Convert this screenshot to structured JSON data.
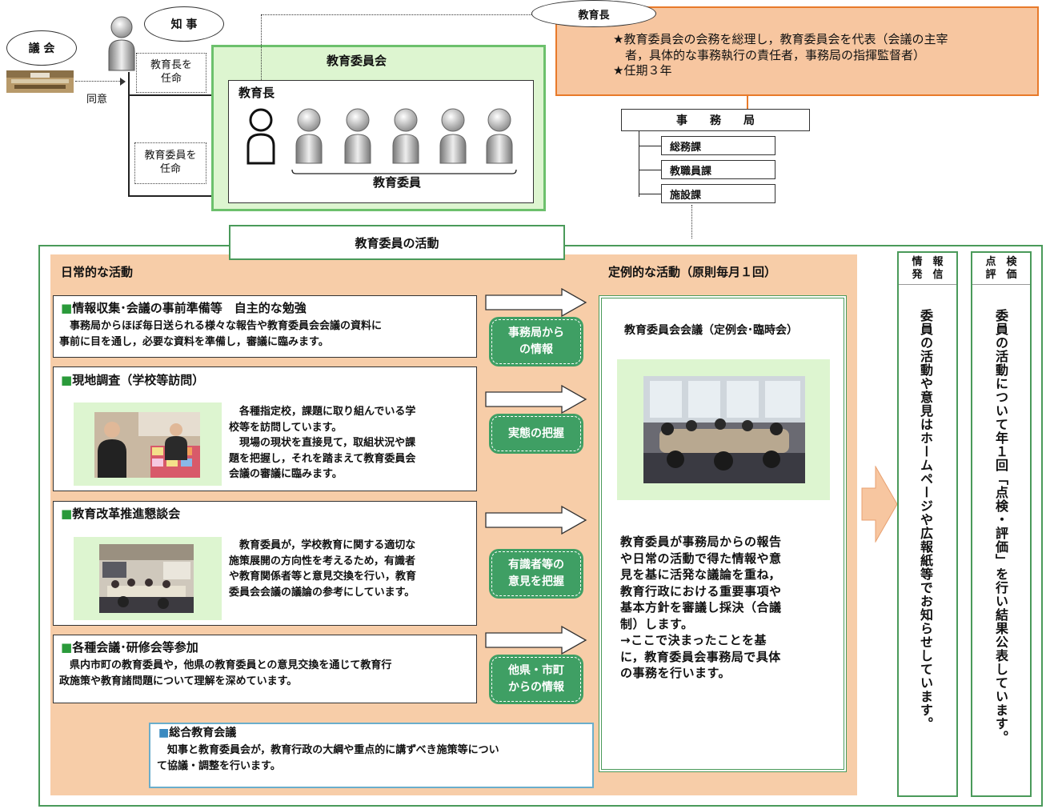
{
  "top": {
    "gikai_label": "議 会",
    "chiji_label": "知 事",
    "kyoikucho_label": "教育長",
    "appoint_superintendent": "教育長を\n任命",
    "appoint_members": "教育委員を\n任命",
    "consent_label": "同意",
    "board_title": "教育委員会",
    "board_superintendent": "教育長",
    "board_members": "教育委員",
    "superintendent_desc": "★教育委員会の会務を総理し，教育委員会を代表（会議の主宰\n　者，具体的な事務執行の責任者，事務局の指揮監督者）\n★任期３年",
    "secretariat": "事　　務　　局",
    "sections": [
      "総務課",
      "教職員課",
      "施設課"
    ]
  },
  "activities": {
    "title": "教育委員の活動",
    "daily_title": "日常的な活動",
    "regular_title": "定例的な活動（原則毎月１回）",
    "items": [
      {
        "heading": "情報収集･会議の事前準備等　自主的な勉強",
        "body": "　事務局からほぼ毎日送られる様々な報告や教育委員会会議の資料に\n事前に目を通し，必要な資料を準備し，審議に臨みます。"
      },
      {
        "heading": "現地調査（学校等訪問）",
        "body": "　各種指定校，課題に取り組んでいる学\n校等を訪問しています。\n　現場の現状を直接見て，取組状況や課\n題を把握し，それを踏まえて教育委員会\n会議の審議に臨みます。"
      },
      {
        "heading": "教育改革推進懇談会",
        "body": "　教育委員が，学校教育に関する適切な\n施策展開の方向性を考えるため，有識者\nや教育関係者等と意見交換を行い，教育\n委員会会議の議論の参考にしています。"
      },
      {
        "heading": "各種会議･研修会等参加",
        "body": "　県内市町の教育委員や，他県の教育委員との意見交換を通じて教育行\n政施策や教育諸問題について理解を深めています。"
      }
    ],
    "general_meeting": {
      "heading": "総合教育会議",
      "body": "　知事と教育委員会が，教育行政の大綱や重点的に講ずべき施策等につい\nて協議・調整を行います。"
    },
    "bubbles": [
      "事務局から\nの情報",
      "実態の把握",
      "有識者等の\n意見を把握",
      "他県・市町\nからの情報"
    ],
    "meeting_title": "教育委員会会議（定例会･臨時会）",
    "meeting_desc": "教育委員が事務局からの報告\nや日常の活動で得た情報や意\n見を基に活発な議論を重ね，\n教育行政における重要事項や\n基本方針を審議し採決（合議\n制）します。\n→ここで決まったことを基\nに，教育委員会事務局で具体\nの事務を行います。",
    "info_title": "情　報\n発　信",
    "info_body": "委員の活動や意見はホームページや広報紙等でお知らせしています。",
    "eval_title": "点　検\n評　価",
    "eval_body": "委員の活動について年１回「点検・評価」を行い結果公表しています。"
  },
  "colors": {
    "orange_fill": "#f7c6a0",
    "orange_border": "#e87a2a",
    "light_green": "#ddf5d0",
    "green_border": "#4a9a5a",
    "peach": "#f7cda8",
    "bubble_green": "#3f9f64"
  }
}
